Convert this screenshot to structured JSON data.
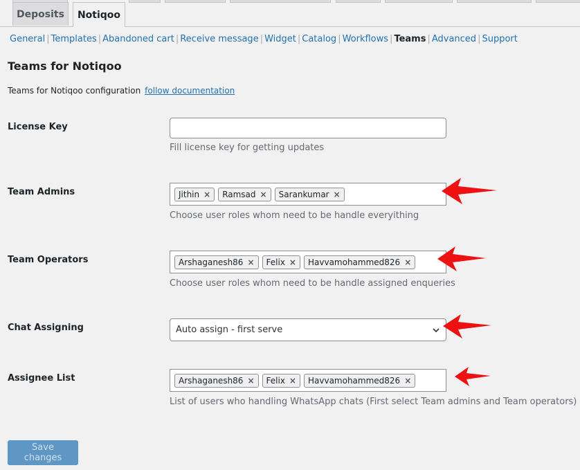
{
  "tabs": [
    {
      "label": "Deposits",
      "active": false
    },
    {
      "label": "Notiqoo",
      "active": true
    }
  ],
  "subnav": [
    {
      "label": "General",
      "current": false
    },
    {
      "label": "Templates",
      "current": false
    },
    {
      "label": "Abandoned cart",
      "current": false
    },
    {
      "label": "Receive message",
      "current": false
    },
    {
      "label": "Widget",
      "current": false
    },
    {
      "label": "Catalog",
      "current": false
    },
    {
      "label": "Workflows",
      "current": false
    },
    {
      "label": "Teams",
      "current": true
    },
    {
      "label": "Advanced",
      "current": false
    },
    {
      "label": "Support",
      "current": false
    }
  ],
  "page": {
    "title": "Teams for Notiqoo",
    "description": "Teams for Notiqoo configuration",
    "doc_link": "follow documentation"
  },
  "fields": {
    "license": {
      "label": "License Key",
      "value": "",
      "help": "Fill license key for getting updates"
    },
    "team_admins": {
      "label": "Team Admins",
      "tags": [
        "Jithin",
        "Ramsad",
        "Sarankumar"
      ],
      "help": "Choose user roles whom need to be handle everyithing"
    },
    "team_operators": {
      "label": "Team Operators",
      "tags": [
        "Arshaganesh86",
        "Felix",
        "Havvamohammed826"
      ],
      "help": "Choose user roles whom need to be handle assigned enqueries"
    },
    "chat_assigning": {
      "label": "Chat Assigning",
      "selected": "Auto assign - first serve"
    },
    "assignee_list": {
      "label": "Assignee List",
      "tags": [
        "Arshaganesh86",
        "Felix",
        "Havvamohammed826"
      ],
      "help": "List of users who handling WhatsApp chats (First select Team admins and Team operators)"
    }
  },
  "tag_remove_glyph": "×",
  "save_button": "Save changes",
  "colors": {
    "link": "#2271b1",
    "primary_button": "#2271b1",
    "annotation_arrow": "#ee1111"
  }
}
